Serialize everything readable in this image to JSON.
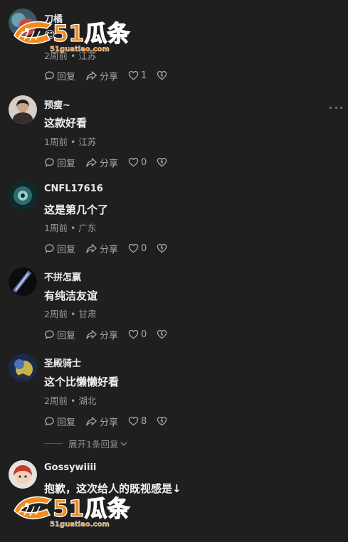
{
  "comments": [
    {
      "user": "刀橘",
      "text": "😊",
      "time": "2周前",
      "location": "江苏",
      "reply_label": "回复",
      "share_label": "分享",
      "likes": "1"
    },
    {
      "user": "预瘦~",
      "text": "这款好看",
      "time": "1周前",
      "location": "江苏",
      "reply_label": "回复",
      "share_label": "分享",
      "likes": "0"
    },
    {
      "user": "CNFL17616",
      "text": "这是第几个了",
      "time": "1周前",
      "location": "广东",
      "reply_label": "回复",
      "share_label": "分享",
      "likes": "0"
    },
    {
      "user": "不拼怎赢",
      "text": "有纯洁友谊",
      "time": "2周前",
      "location": "甘肃",
      "reply_label": "回复",
      "share_label": "分享",
      "likes": "0"
    },
    {
      "user": "圣殿骑士",
      "text": "这个比懒懒好看",
      "time": "2周前",
      "location": "湖北",
      "reply_label": "回复",
      "share_label": "分享",
      "likes": "8"
    },
    {
      "user": "Gossywiiii",
      "text": "抱歉，这次给人的既视感是↓"
    }
  ],
  "separator": "•",
  "expand_replies": "展开1条回复",
  "watermark": {
    "brand": "51瓜条",
    "url": "51guatiao.com"
  },
  "icons": {
    "reply": "speech-bubble-icon",
    "share": "share-arrow-icon",
    "like": "heart-icon",
    "dislike": "broken-heart-icon",
    "more": "more-dots-icon"
  },
  "colors": {
    "background": "#1f1f1f",
    "watermark_orange": "#f28a1c"
  }
}
